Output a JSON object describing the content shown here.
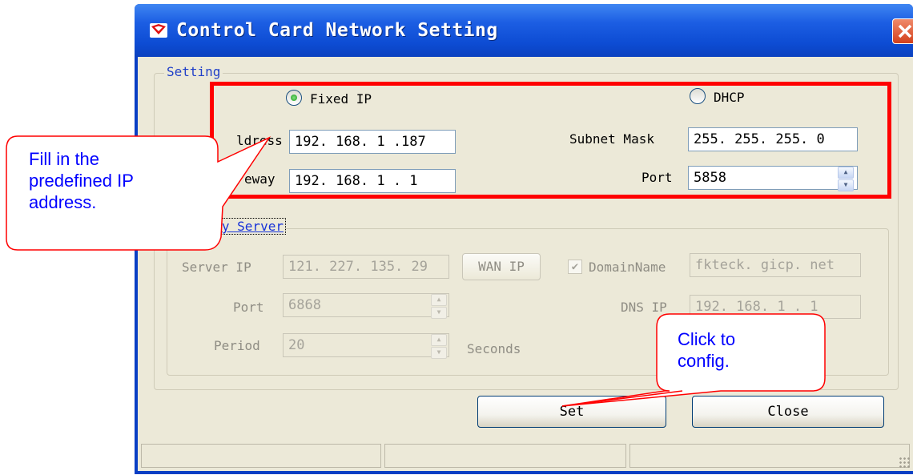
{
  "window": {
    "title": "Control Card Network Setting",
    "close_glyph": "✕"
  },
  "setting": {
    "legend": "Setting",
    "fixed_ip_label": "Fixed IP",
    "dhcp_label": "DHCP",
    "mode_selected": "Fixed IP",
    "ip_address_label": "IP Address",
    "ip_address_visible": "ldress",
    "ip_address_value": "192. 168.  1 .187",
    "gateway_label": "Gateway",
    "gateway_visible": "eway",
    "gateway_value": "192. 168.  1 .  1",
    "subnet_mask_label": "Subnet Mask",
    "subnet_mask_value": "255. 255. 255.  0",
    "port_label": "Port",
    "port_value": "5858"
  },
  "notify": {
    "legend": "Notify Server",
    "legend_visible": "tify Server",
    "server_ip_label": "Server IP",
    "server_ip_value": "121. 227. 135. 29",
    "wan_ip_button": "WAN IP",
    "domain_name_label": "DomainName",
    "domain_name_checked": true,
    "domain_name_value": "fkteck. gicp. net",
    "port_label": "Port",
    "port_value": "6868",
    "dns_ip_label": "DNS IP",
    "dns_ip_value": "192. 168.  1 .  1",
    "period_label": "Period",
    "period_value": "20",
    "seconds_label": "Seconds"
  },
  "buttons": {
    "set_label": "Set",
    "close_label": "Close"
  },
  "annotations": {
    "callout_left_lines": [
      "Fill in the",
      "predefined IP",
      "address."
    ],
    "callout_right_lines": [
      "Click to",
      "config."
    ],
    "highlight_color": "#ff0000",
    "callout_text_color": "#0000ff"
  },
  "icons": {
    "title_icon": "app-logo-icon",
    "close_icon": "close-icon",
    "spin_up": "▲",
    "spin_down": "▼",
    "check": "✔"
  },
  "colors": {
    "titlebar": "#1c5ee3",
    "client_bg": "#ece9d8",
    "legend_text": "#1f3fc8"
  }
}
